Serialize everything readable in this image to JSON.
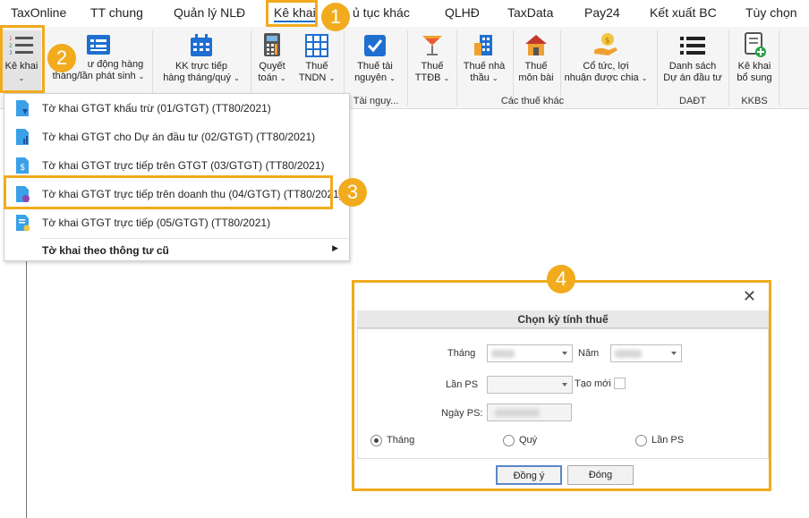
{
  "menubar": {
    "tabs": [
      "TaxOnline",
      "TT chung",
      "Quản lý NLĐ",
      "Kê khai",
      "ủ tục khác",
      "QLHĐ",
      "TaxData",
      "Pay24",
      "Kết xuất BC",
      "Tùy chọn"
    ],
    "active_tab": "Kê khai"
  },
  "ribbon": {
    "ke_khai_btn": "Kê khai",
    "tu_dong_line1": "ư động hàng",
    "tu_dong_line2": "tháng/lần phát sinh",
    "kk_line1": "KK trực tiếp",
    "kk_line2": "hàng tháng/quý",
    "quyet_line1": "Quyết",
    "quyet_line2": "toán",
    "tndn_line1": "Thuế",
    "tndn_line2": "TNDN",
    "tn_line1": "Thuế tài",
    "tn_line2": "nguyên",
    "ttdb_line1": "Thuế",
    "ttdb_line2": "TTĐB",
    "nhathau_line1": "Thuế nhà",
    "nhathau_line2": "thầu",
    "monbai_line1": "Thuế",
    "monbai_line2": "môn bài",
    "cotuc_line1": "Cổ tức, lợi",
    "cotuc_line2": "nhuận được chia",
    "dadt_line1": "Danh sách",
    "dadt_line2": "Dự án đầu tư",
    "kbs_line1": "Kê khai",
    "kbs_line2": "bổ sung",
    "group_tainguyen": "Tài nguy...",
    "group_cacthue": "Các thuế khác",
    "group_dadt": "DAĐT",
    "group_kkbs": "KKBS"
  },
  "dropdown": {
    "items": [
      "Tờ khai GTGT khấu trừ (01/GTGT) (TT80/2021)",
      "Tờ khai GTGT cho Dự án đầu tư (02/GTGT) (TT80/2021)",
      "Tờ khai GTGT trực tiếp trên GTGT (03/GTGT) (TT80/2021)",
      "Tờ khai GTGT trực tiếp trên doanh thu (04/GTGT) (TT80/2021)",
      "Tờ khai GTGT trực tiếp (05/GTGT) (TT80/2021)"
    ],
    "old_forms": "Tờ khai theo thông tư cũ"
  },
  "dialog": {
    "title": "Chọn kỳ tính thuế",
    "thang_label": "Tháng",
    "nam_label": "Năm",
    "lanps_label": "Lần PS",
    "taomoi_label": "Tạo mới",
    "ngayps_label": "Ngày PS:",
    "radio_thang": "Tháng",
    "radio_quy": "Quý",
    "radio_lanps": "Lần PS",
    "ok_button": "Đồng ý",
    "close_button": "Đóng",
    "selected_period": "Tháng"
  },
  "callouts": [
    "1",
    "2",
    "3",
    "4"
  ],
  "colors": {
    "accent": "#f1ab1d",
    "tab_underline": "#1f6fd0"
  },
  "icons": [
    "list-icon",
    "form-icon",
    "calendar-icon",
    "calculator-icon",
    "grid-icon",
    "checkbox-icon",
    "cocktail-icon",
    "building-icon",
    "house-icon",
    "money-hand-icon",
    "list-bullet-icon",
    "document-plus-icon",
    "close-icon"
  ]
}
